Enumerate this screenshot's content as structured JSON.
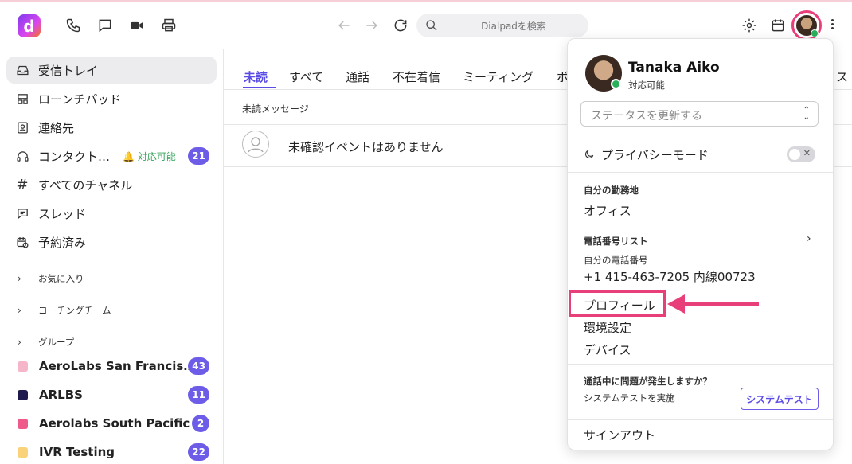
{
  "app": {
    "logo_text": "d"
  },
  "topbar": {
    "search_placeholder": "Dialpadを検索"
  },
  "sidebar": {
    "items": [
      {
        "label": "受信トレイ",
        "icon": "inbox-icon",
        "active": true
      },
      {
        "label": "ローンチパッド",
        "icon": "launchpad-icon"
      },
      {
        "label": "連絡先",
        "icon": "contacts-icon"
      },
      {
        "label": "コンタクト…",
        "icon": "headset-icon",
        "status": "対応可能",
        "badge": "21"
      },
      {
        "label": "すべてのチャネル",
        "icon": "hash-icon"
      },
      {
        "label": "スレッド",
        "icon": "thread-icon"
      },
      {
        "label": "予約済み",
        "icon": "scheduled-icon"
      }
    ],
    "sections": [
      {
        "label": "お気に入り"
      },
      {
        "label": "コーチングチーム"
      },
      {
        "label": "グループ"
      }
    ],
    "groups": [
      {
        "label": "AeroLabs San Francis…",
        "badge": "43",
        "color": "#f4b6c8"
      },
      {
        "label": "ARLBS",
        "badge": "11",
        "color": "#1e1a4d"
      },
      {
        "label": "Aerolabs South Pacific",
        "badge": "2",
        "color": "#ee5a8a"
      },
      {
        "label": "IVR Testing",
        "badge": "22",
        "color": "#fad27a"
      }
    ]
  },
  "main": {
    "tabs": [
      "未読",
      "すべて",
      "通話",
      "不在着信",
      "ミーティング",
      "ボ"
    ],
    "tab_cut_right": "ス",
    "subheader": "未読メッセージ",
    "empty_text": "未確認イベントはありません"
  },
  "menu": {
    "name": "Tanaka Aiko",
    "status": "対応可能",
    "status_select_placeholder": "ステータスを更新する",
    "privacy_label": "プライバシーモード",
    "privacy_on": false,
    "work_location_label": "自分の勤務地",
    "work_location_value": "オフィス",
    "phone_list_label": "電話番号リスト",
    "my_number_label": "自分の電話番号",
    "my_number_value": "+1 415-463-7205 内線00723",
    "items": [
      "プロフィール",
      "環境設定",
      "デバイス"
    ],
    "call_issue_label": "通話中に問題が発生しますか？",
    "system_test_text": "システムテストを実施",
    "system_test_button": "システムテスト",
    "sign_out": "サインアウト"
  },
  "colors": {
    "accent": "#5b4ce6",
    "badge": "#6c5ce7",
    "highlight": "#e83e7a",
    "online": "#2bb05a"
  }
}
